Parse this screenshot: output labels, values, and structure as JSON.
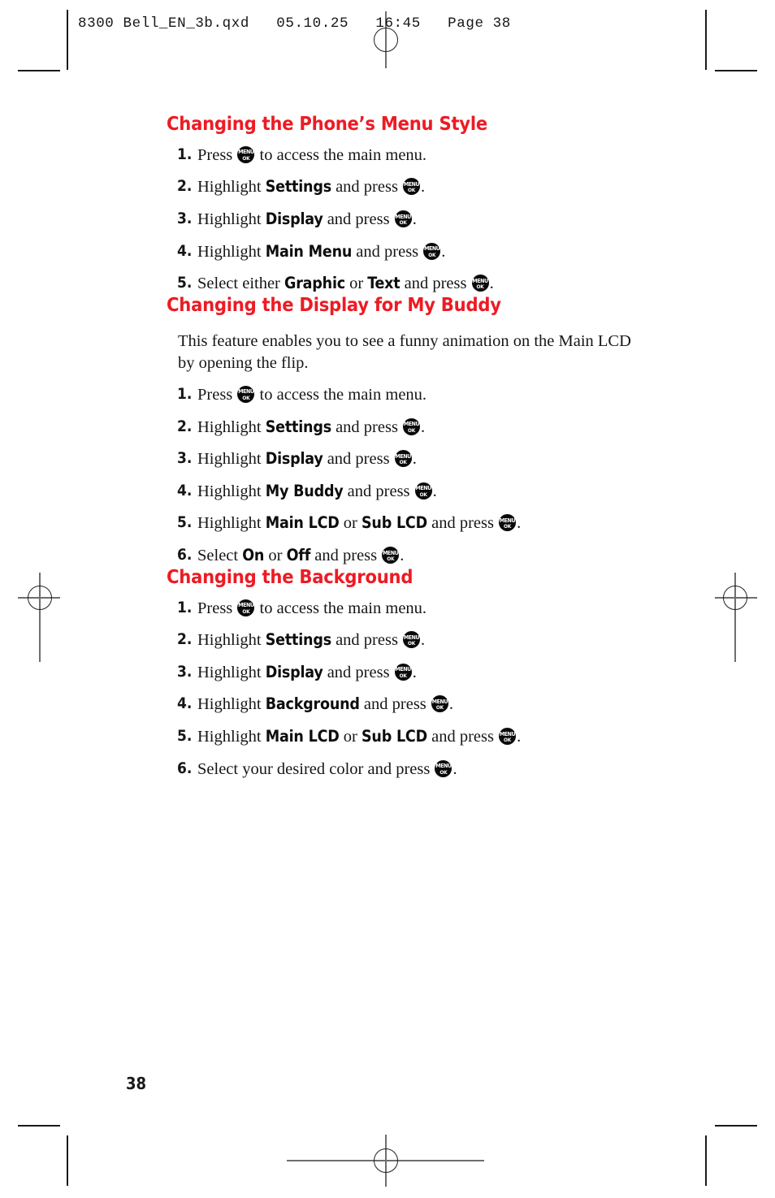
{
  "page_header": {
    "text": "8300 Bell_EN_3b.qxd   05.10.25   16:45   Page 38"
  },
  "folio": {
    "page_number": "38"
  },
  "colors": {
    "heading_red": "#ed1b24",
    "body_text": "#161616",
    "key_glyph_fill": "#0a0a0a"
  },
  "key_icon": {
    "line1": "MENU",
    "line2": "OK"
  },
  "sections": [
    {
      "title": "Changing the Phone’s Menu Style",
      "intro": null,
      "steps": [
        {
          "num": "1.",
          "parts": [
            {
              "t": "text",
              "v": "Press "
            },
            {
              "t": "key"
            },
            {
              "t": "text",
              "v": " to access the main menu."
            }
          ]
        },
        {
          "num": "2.",
          "parts": [
            {
              "t": "text",
              "v": "Highlight "
            },
            {
              "t": "kw",
              "v": "Settings"
            },
            {
              "t": "text",
              "v": " and press "
            },
            {
              "t": "key"
            },
            {
              "t": "text",
              "v": "."
            }
          ]
        },
        {
          "num": "3.",
          "parts": [
            {
              "t": "text",
              "v": "Highlight "
            },
            {
              "t": "kw",
              "v": "Display"
            },
            {
              "t": "text",
              "v": " and press "
            },
            {
              "t": "key"
            },
            {
              "t": "text",
              "v": "."
            }
          ]
        },
        {
          "num": "4.",
          "parts": [
            {
              "t": "text",
              "v": "Highlight "
            },
            {
              "t": "kw",
              "v": "Main Menu"
            },
            {
              "t": "text",
              "v": " and press "
            },
            {
              "t": "key"
            },
            {
              "t": "text",
              "v": "."
            }
          ]
        },
        {
          "num": "5.",
          "parts": [
            {
              "t": "text",
              "v": "Select either "
            },
            {
              "t": "kw",
              "v": "Graphic"
            },
            {
              "t": "text",
              "v": " or "
            },
            {
              "t": "kw",
              "v": "Text"
            },
            {
              "t": "text",
              "v": " and press "
            },
            {
              "t": "key"
            },
            {
              "t": "text",
              "v": "."
            }
          ]
        }
      ]
    },
    {
      "title": "Changing the Display for My Buddy",
      "intro": "This feature enables you to see a funny animation on the Main LCD by opening the flip.",
      "steps": [
        {
          "num": "1.",
          "parts": [
            {
              "t": "text",
              "v": "Press "
            },
            {
              "t": "key"
            },
            {
              "t": "text",
              "v": " to access the main menu."
            }
          ]
        },
        {
          "num": "2.",
          "parts": [
            {
              "t": "text",
              "v": "Highlight "
            },
            {
              "t": "kw",
              "v": "Settings"
            },
            {
              "t": "text",
              "v": " and press "
            },
            {
              "t": "key"
            },
            {
              "t": "text",
              "v": "."
            }
          ]
        },
        {
          "num": "3.",
          "parts": [
            {
              "t": "text",
              "v": "Highlight "
            },
            {
              "t": "kw",
              "v": "Display"
            },
            {
              "t": "text",
              "v": " and press "
            },
            {
              "t": "key"
            },
            {
              "t": "text",
              "v": "."
            }
          ]
        },
        {
          "num": "4.",
          "parts": [
            {
              "t": "text",
              "v": "Highlight "
            },
            {
              "t": "kw",
              "v": "My Buddy"
            },
            {
              "t": "text",
              "v": " and press "
            },
            {
              "t": "key"
            },
            {
              "t": "text",
              "v": "."
            }
          ]
        },
        {
          "num": "5.",
          "parts": [
            {
              "t": "text",
              "v": "Highlight "
            },
            {
              "t": "kw",
              "v": "Main LCD"
            },
            {
              "t": "text",
              "v": " or "
            },
            {
              "t": "kw",
              "v": "Sub LCD"
            },
            {
              "t": "text",
              "v": " and press "
            },
            {
              "t": "key"
            },
            {
              "t": "text",
              "v": "."
            }
          ]
        },
        {
          "num": "6.",
          "parts": [
            {
              "t": "text",
              "v": "Select "
            },
            {
              "t": "kw",
              "v": "On"
            },
            {
              "t": "text",
              "v": " or "
            },
            {
              "t": "kw",
              "v": "Off"
            },
            {
              "t": "text",
              "v": " and press "
            },
            {
              "t": "key"
            },
            {
              "t": "text",
              "v": "."
            }
          ]
        }
      ]
    },
    {
      "title": "Changing the Background",
      "intro": null,
      "steps": [
        {
          "num": "1.",
          "parts": [
            {
              "t": "text",
              "v": "Press "
            },
            {
              "t": "key"
            },
            {
              "t": "text",
              "v": " to access the main menu."
            }
          ]
        },
        {
          "num": "2.",
          "parts": [
            {
              "t": "text",
              "v": "Highlight "
            },
            {
              "t": "kw",
              "v": "Settings"
            },
            {
              "t": "text",
              "v": " and press "
            },
            {
              "t": "key"
            },
            {
              "t": "text",
              "v": "."
            }
          ]
        },
        {
          "num": "3.",
          "parts": [
            {
              "t": "text",
              "v": "Highlight "
            },
            {
              "t": "kw",
              "v": "Display"
            },
            {
              "t": "text",
              "v": " and press "
            },
            {
              "t": "key"
            },
            {
              "t": "text",
              "v": "."
            }
          ]
        },
        {
          "num": "4.",
          "parts": [
            {
              "t": "text",
              "v": "Highlight "
            },
            {
              "t": "kw",
              "v": "Background"
            },
            {
              "t": "text",
              "v": " and press "
            },
            {
              "t": "key"
            },
            {
              "t": "text",
              "v": "."
            }
          ]
        },
        {
          "num": "5.",
          "parts": [
            {
              "t": "text",
              "v": "Highlight "
            },
            {
              "t": "kw",
              "v": "Main LCD"
            },
            {
              "t": "text",
              "v": " or "
            },
            {
              "t": "kw",
              "v": "Sub LCD"
            },
            {
              "t": "text",
              "v": " and press "
            },
            {
              "t": "key"
            },
            {
              "t": "text",
              "v": "."
            }
          ]
        },
        {
          "num": "6.",
          "parts": [
            {
              "t": "text",
              "v": "Select your desired color and press "
            },
            {
              "t": "key"
            },
            {
              "t": "text",
              "v": "."
            }
          ]
        }
      ]
    }
  ]
}
